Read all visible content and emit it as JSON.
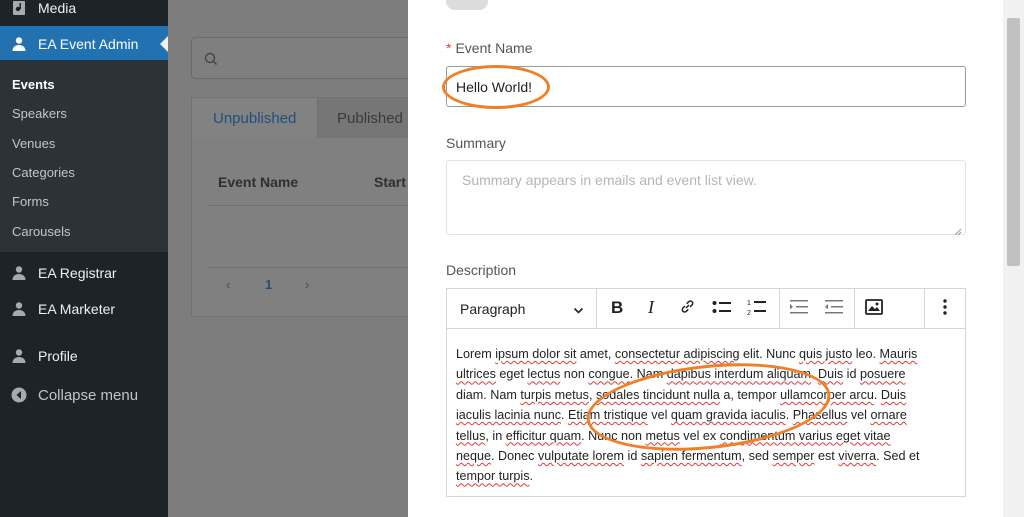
{
  "sidebar": {
    "media": "Media",
    "ea_event_admin": "EA Event Admin",
    "sub_items": [
      "Events",
      "Speakers",
      "Venues",
      "Categories",
      "Forms",
      "Carousels"
    ],
    "ea_registrar": "EA Registrar",
    "ea_marketer": "EA Marketer",
    "profile": "Profile",
    "collapse": "Collapse menu"
  },
  "list_panel": {
    "tabs": [
      "Unpublished",
      "Published"
    ],
    "column_headers": [
      "Event Name",
      "Start"
    ],
    "pagination": {
      "prev": "‹",
      "current": "1",
      "next": "›"
    }
  },
  "form": {
    "event_name": {
      "label": "Event Name",
      "required_mark": "*",
      "value": "Hello World!"
    },
    "summary": {
      "label": "Summary",
      "placeholder": "Summary appears in emails and event list view."
    },
    "description": {
      "label": "Description",
      "block_format": "Paragraph",
      "lines": [
        "Lorem ipsum dolor sit amet, consectetur adipiscing elit. Nunc quis justo leo. Mauris",
        "ultrices eget lectus non congue. Nam dapibus interdum aliquam. Duis id posuere",
        "diam. Nam turpis metus, sodales tincidunt nulla a, tempor ullamcorper arcu. Duis",
        "iaculis lacinia nunc. Etiam tristique vel quam gravida iaculis. Phasellus vel ornare",
        "tellus, in efficitur quam. Nunc non metus vel ex condimentum varius eget vitae",
        "neque. Donec vulputate lorem id sapien fermentum, sed semper est viverra. Sed et",
        "tempor turpis."
      ]
    }
  },
  "colors": {
    "sidebar_bg": "#1d2327",
    "active": "#2271b1",
    "annotation": "#f07f2a",
    "required": "#e53935"
  }
}
